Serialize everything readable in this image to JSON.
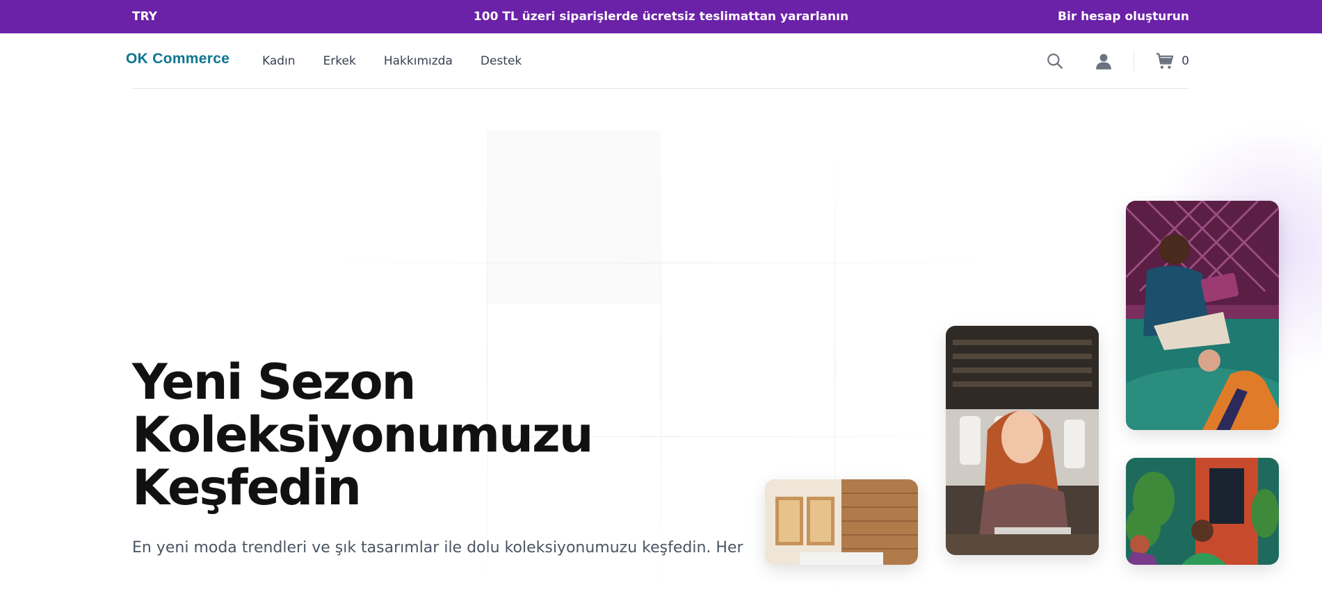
{
  "topbar": {
    "currency": "TRY",
    "promo": "100 TL üzeri siparişlerde ücretsiz teslimattan yararlanın",
    "create_account": "Bir hesap oluşturun"
  },
  "nav": {
    "logo": "OK Commerce",
    "links": [
      "Kadın",
      "Erkek",
      "Hakkımızda",
      "Destek"
    ],
    "cart_count": "0"
  },
  "hero": {
    "title_lines": [
      "Yeni Sezon",
      "Koleksiyonumuzu",
      "Keşfedin"
    ],
    "description": "En yeni moda trendleri ve şık tasarımlar ile dolu koleksiyonumuzu keşfedin. Her"
  },
  "colors": {
    "brand_purple": "#6b21a8",
    "logo_teal": "#0e7490"
  },
  "icons": [
    "search-icon",
    "user-icon",
    "cart-icon"
  ]
}
